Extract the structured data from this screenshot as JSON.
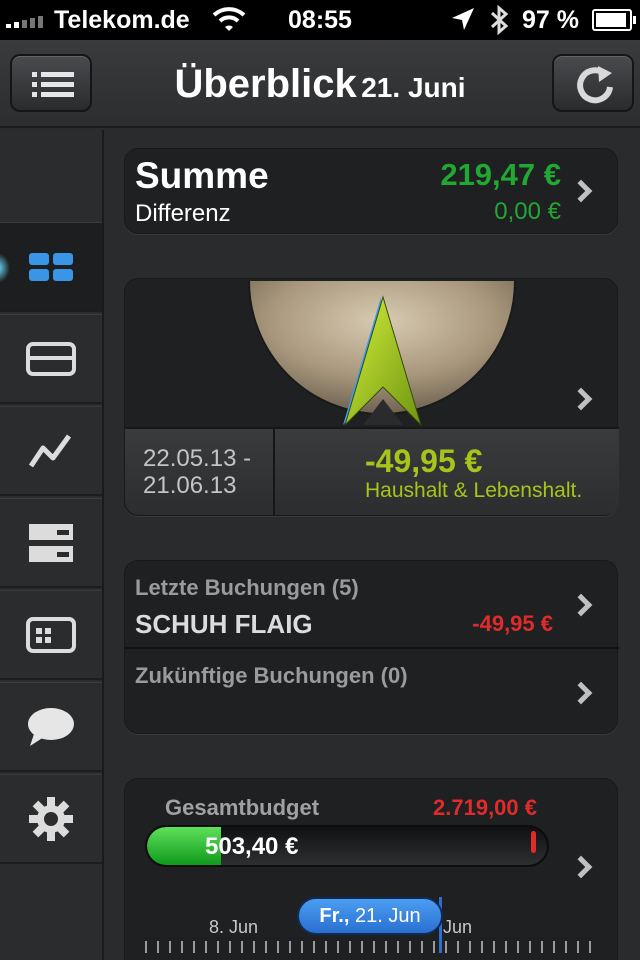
{
  "status_bar": {
    "carrier": "Telekom.de",
    "time": "08:55",
    "battery_text": "97 %",
    "icons": [
      "signal-icon",
      "wifi-icon",
      "location-icon",
      "bluetooth-icon",
      "battery-icon"
    ]
  },
  "nav": {
    "title": "Überblick",
    "date": "21. Juni",
    "left_button_icon": "menu-list-icon",
    "right_button_icon": "refresh-icon"
  },
  "sidebar": {
    "items": [
      {
        "icon": "overview-grid-icon",
        "active": true
      },
      {
        "icon": "accounts-card-icon",
        "active": false
      },
      {
        "icon": "chart-line-icon",
        "active": false
      },
      {
        "icon": "budget-rows-icon",
        "active": false
      },
      {
        "icon": "bookings-panel-icon",
        "active": false
      },
      {
        "icon": "chat-bubble-icon",
        "active": false
      },
      {
        "icon": "gear-icon",
        "active": false
      }
    ]
  },
  "summary": {
    "title": "Summe",
    "subtitle": "Differenz",
    "value": "219,47 €",
    "difference": "0,00 €"
  },
  "gauge": {
    "date_from": "22.05.13 -",
    "date_to": "21.06.13",
    "amount": "-49,95 €",
    "category": "Haushalt & Lebenshalt."
  },
  "bookings": {
    "last_label": "Letzte Buchungen (5)",
    "last_merchant": "SCHUH FLAIG",
    "last_amount": "-49,95 €",
    "future_label": "Zukünftige Buchungen (0)"
  },
  "budget": {
    "label": "Gesamtbudget",
    "total": "2.719,00 €",
    "used": "503,40 €",
    "used_fraction": 0.185,
    "date_day": "Fr.,",
    "date_rest": "21. Jun",
    "tick_left": "8. Jun",
    "tick_right": "Jun"
  },
  "colors": {
    "positive": "#21a832",
    "negative": "#e02b2b",
    "category": "#a6c41a",
    "accent_blue": "#2a6fd1"
  }
}
